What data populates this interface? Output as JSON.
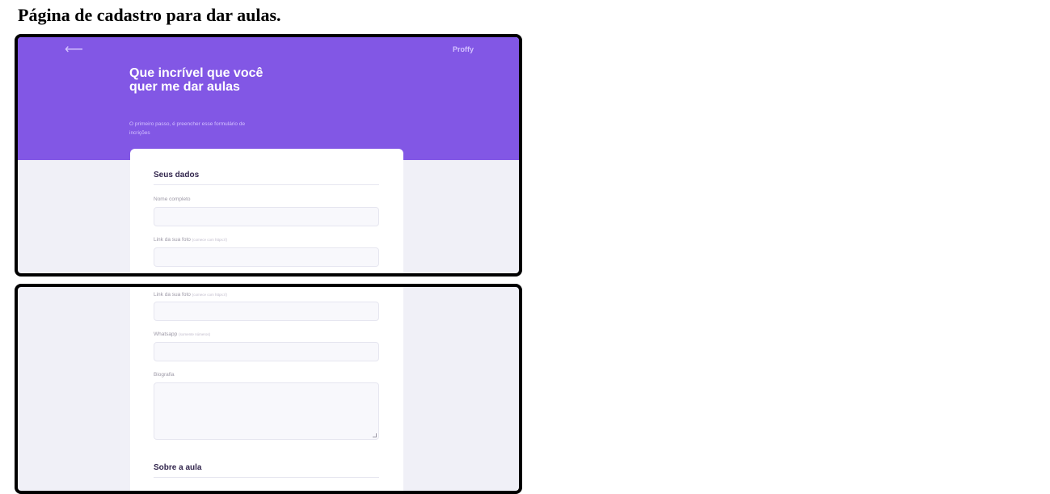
{
  "caption": "Página de cadastro para dar aulas.",
  "header": {
    "back_arrow": "⟵",
    "brand": "Proffy",
    "title": "Que incrível que você quer me dar aulas",
    "subtitle": "O primeiro passo, é preencher esse formulário de incrições"
  },
  "form": {
    "section_your_data": "Seus dados",
    "name_label": "Nome completo",
    "photo_label": "Link da sua foto",
    "photo_hint": "(comece com https://)",
    "whatsapp_label": "Whatsapp",
    "whatsapp_hint": "(somente números)",
    "bio_label": "Biografia",
    "section_class": "Sobre a aula"
  },
  "colors": {
    "primary": "#8257e5",
    "background": "#f0f0f7",
    "title_text": "#32264d"
  }
}
